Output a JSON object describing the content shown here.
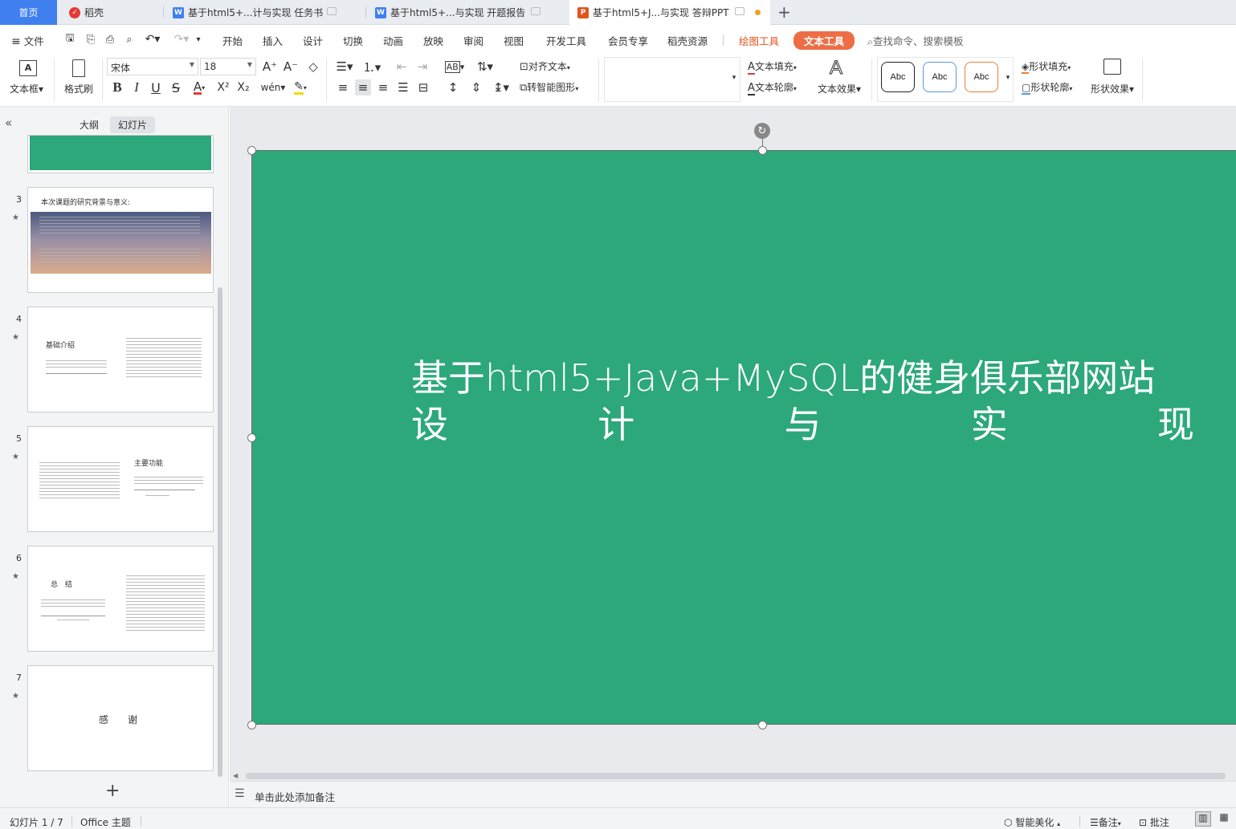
{
  "tabs": [
    {
      "label": "首页",
      "type": "home"
    },
    {
      "label": "稻壳",
      "icon": "docer-icon"
    },
    {
      "label": "基于html5+...计与实现 任务书",
      "icon": "word-doc-icon"
    },
    {
      "label": "基于html5+...与实现 开题报告",
      "icon": "word-doc-icon"
    },
    {
      "label": "基于html5+J...与实现 答辩PPT",
      "icon": "ppt-icon",
      "active": true
    }
  ],
  "menu": {
    "file": "文件",
    "items": [
      "开始",
      "插入",
      "设计",
      "切换",
      "动画",
      "放映",
      "审阅",
      "视图",
      "开发工具",
      "会员专享",
      "稻壳资源"
    ],
    "drawing_tools": "绘图工具",
    "text_tools": "文本工具",
    "search_placeholder": "查找命令、搜索模板"
  },
  "ribbon": {
    "textbox": "文本框",
    "format_painter": "格式刷",
    "font_name": "宋体",
    "font_size": "18",
    "align_text": "对齐文本",
    "smart_shape": "转智能图形",
    "text_fill": "文本填充",
    "text_outline": "文本轮廓",
    "text_effect": "文本效果",
    "shape_fill": "形状填充",
    "shape_outline": "形状轮廓",
    "shape_effect": "形状效果",
    "style_sample": "Abc",
    "art_letter": "A"
  },
  "panel": {
    "outline_tab": "大纲",
    "slides_tab": "幻灯片",
    "add_icon": "plus-icon"
  },
  "slides": [
    {
      "num": "3",
      "title": "本次课题的研究背景与意义:"
    },
    {
      "num": "4",
      "title": "基础介绍"
    },
    {
      "num": "5",
      "title": "主要功能"
    },
    {
      "num": "6",
      "title": "总　结"
    },
    {
      "num": "7",
      "title": "感　　谢"
    }
  ],
  "slide": {
    "title_line1": "基于html5+Java+MySQL的健身俱乐部网站",
    "title_line2": [
      "设",
      "计",
      "与",
      "实",
      "现"
    ],
    "bg_color": "#2ca87b"
  },
  "notes_placeholder": "单击此处添加备注",
  "status": {
    "slide_count": "幻灯片 1 / 7",
    "theme": "Office 主题",
    "smart_beautify": "智能美化",
    "notes": "备注",
    "comments": "批注"
  },
  "colors": {
    "accent": "#3f7ff0",
    "brand": "#ed6e45",
    "slide": "#2ca87b"
  }
}
